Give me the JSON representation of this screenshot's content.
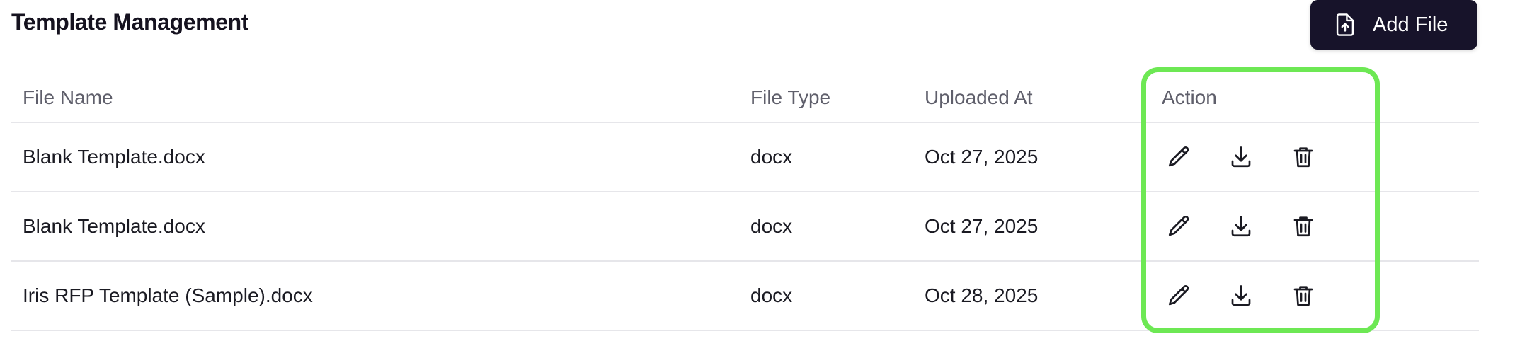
{
  "page_title": "Template Management",
  "add_file_label": "Add File",
  "table": {
    "columns": [
      "File Name",
      "File Type",
      "Uploaded At",
      "Action"
    ],
    "rows": [
      {
        "file_name": "Blank Template.docx",
        "file_type": "docx",
        "uploaded_at": "Oct 27, 2025"
      },
      {
        "file_name": "Blank Template.docx",
        "file_type": "docx",
        "uploaded_at": "Oct 27, 2025"
      },
      {
        "file_name": "Iris RFP Template (Sample).docx",
        "file_type": "docx",
        "uploaded_at": "Oct 28, 2025"
      }
    ]
  },
  "icons": {
    "add_file": "file-upload-icon",
    "edit": "pencil-icon",
    "download": "download-icon",
    "delete": "trash-icon"
  },
  "colors": {
    "primary_button": "#17132a",
    "highlight": "#6de854"
  }
}
